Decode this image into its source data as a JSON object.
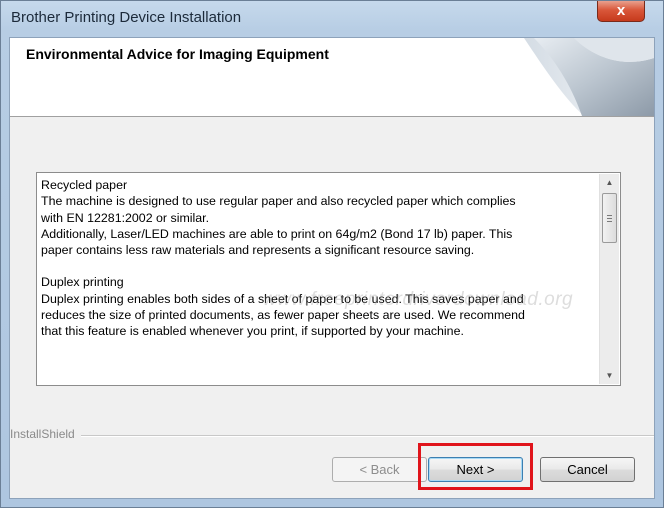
{
  "window": {
    "title": "Brother Printing Device Installation",
    "close_glyph": "x"
  },
  "header": {
    "title": "Environmental Advice for Imaging Equipment"
  },
  "content": {
    "recycled_heading": "Recycled paper",
    "recycled_line1": "The machine is designed to use regular paper and also recycled paper which complies",
    "recycled_line2": "with EN 12281:2002 or similar.",
    "recycled_line3": "Additionally, Laser/LED machines are able to print on 64g/m2 (Bond 17 lb) paper. This",
    "recycled_line4": "paper contains less raw materials and represents a significant resource saving.",
    "duplex_heading": "Duplex printing",
    "duplex_line1": "Duplex printing enables both sides of a sheet of paper to be used. This saves paper and",
    "duplex_line2": "reduces the size of printed documents, as fewer paper sheets are used. We recommend",
    "duplex_line3": "that this feature is enabled whenever you print, if supported by your machine.",
    "watermark": "www.freeprinterdriverdownload.org"
  },
  "footer": {
    "brand": "InstallShield"
  },
  "buttons": {
    "back_label": "< Back",
    "next_label": "Next >",
    "cancel_label": "Cancel"
  },
  "colors": {
    "highlight": "#e0141b",
    "close_button": "#c63a1c",
    "title_bar": "#b7cde4"
  },
  "icons": {
    "close": "close-icon",
    "scroll_up": "scroll-up-arrow-icon",
    "scroll_down": "scroll-down-arrow-icon"
  }
}
